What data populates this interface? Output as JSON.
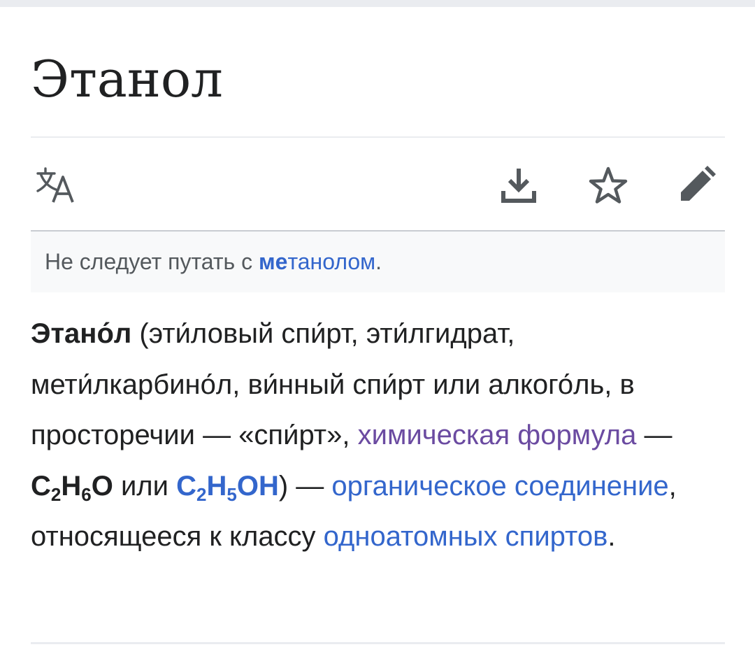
{
  "page": {
    "title": "Этанол"
  },
  "toolbar": {
    "language_icon": "language-icon",
    "download_icon": "download-icon",
    "watch_icon": "star-icon",
    "edit_icon": "pencil-icon"
  },
  "hatnote": {
    "prefix": "Не следует путать с ",
    "link_bold": "ме",
    "link_rest": "танолом",
    "suffix": "."
  },
  "lead": {
    "term": "Этано́л",
    "p1": " (эти́ловый спи́рт, эти́лгидрат, мети́лкарбино́л, ви́нный спи́рт или алкого́ль, в просторечии — «спи́рт», ",
    "link_formula": "химическая формула",
    "p2": " — ",
    "f1": {
      "a": "C",
      "a_sub": "2",
      "b": "H",
      "b_sub": "6",
      "c": "O"
    },
    "p3": " или ",
    "f2": {
      "a": "C",
      "a_sub": "2",
      "b": "H",
      "b_sub": "5",
      "c": "OH"
    },
    "p4": ") — ",
    "link_organic": "органическое соединение",
    "p5": ", относящееся к классу ",
    "link_alcohols": "одноатомных спиртов",
    "p6": "."
  },
  "colors": {
    "link": "#3366cc",
    "visited_link": "#6b4ba1",
    "text": "#202122",
    "hatnote_bg": "#f8f9fa",
    "icon": "#54595d"
  }
}
